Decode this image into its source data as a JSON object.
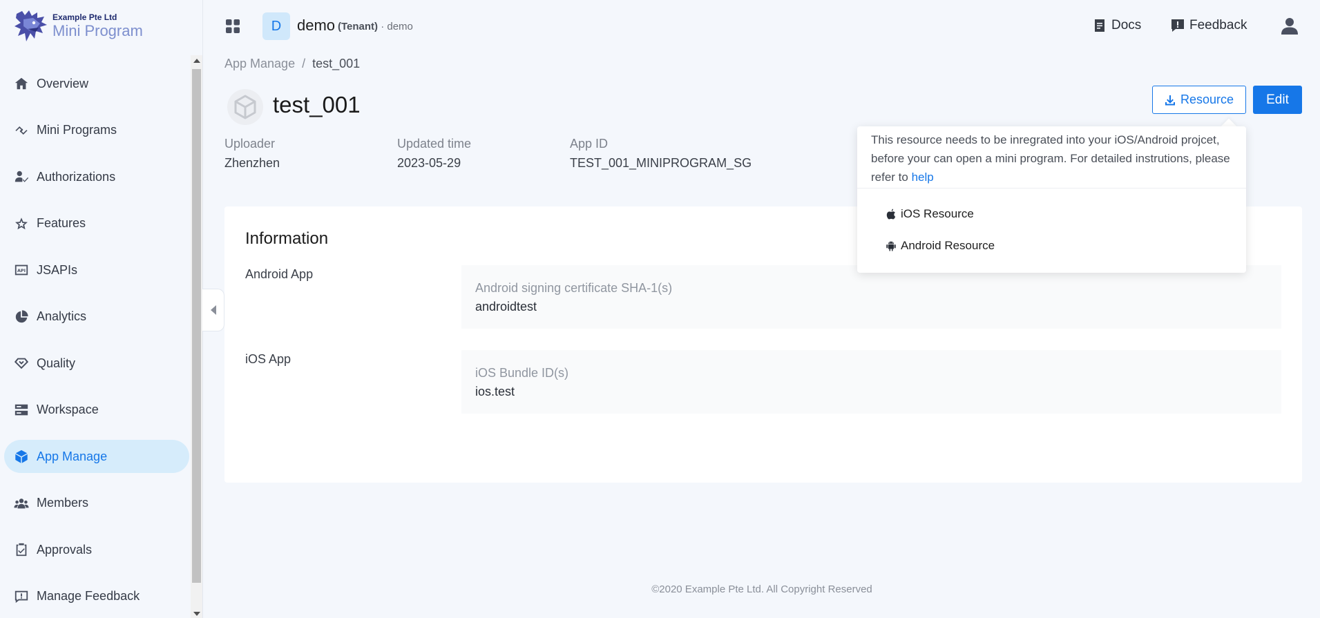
{
  "logo": {
    "company": "Example Pte Ltd",
    "product": "Mini Program",
    "icon": "dragon-logo-icon"
  },
  "sidebar": {
    "items": [
      {
        "label": "Overview",
        "icon": "home-icon"
      },
      {
        "label": "Mini Programs",
        "icon": "link-icon"
      },
      {
        "label": "Authorizations",
        "icon": "user-check-icon"
      },
      {
        "label": "Features",
        "icon": "star-icon"
      },
      {
        "label": "JSAPIs",
        "icon": "api-icon"
      },
      {
        "label": "Analytics",
        "icon": "pie-chart-icon"
      },
      {
        "label": "Quality",
        "icon": "diamond-icon"
      },
      {
        "label": "Workspace",
        "icon": "server-icon"
      },
      {
        "label": "App Manage",
        "icon": "cube-icon",
        "active": true
      },
      {
        "label": "Members",
        "icon": "team-icon"
      },
      {
        "label": "Approvals",
        "icon": "clipboard-check-icon"
      },
      {
        "label": "Manage Feedback",
        "icon": "message-alert-icon"
      }
    ]
  },
  "header": {
    "tenant_initial": "D",
    "tenant_name": "demo",
    "tenant_type": "(Tenant)",
    "tenant_meta": " · demo",
    "docs_label": "Docs",
    "feedback_label": "Feedback"
  },
  "breadcrumb": {
    "parent": "App Manage",
    "separator": "/",
    "current": "test_001"
  },
  "app": {
    "title": "test_001",
    "meta": [
      {
        "label": "Uploader",
        "value": "Zhenzhen"
      },
      {
        "label": "Updated time",
        "value": "2023-05-29"
      },
      {
        "label": "App ID",
        "value": "TEST_001_MINIPROGRAM_SG"
      }
    ]
  },
  "actions": {
    "resource_label": "Resource",
    "edit_label": "Edit"
  },
  "popover": {
    "text": "This resource needs to be inregrated into your iOS/Android projcet, before your can open a mini program. For detailed instrutions, please refer to ",
    "link": "help",
    "ios_label": "iOS Resource",
    "android_label": "Android Resource"
  },
  "information": {
    "title": "Information",
    "rows": [
      {
        "label": "Android App",
        "key": "Android signing certificate SHA-1(s)",
        "value": "androidtest"
      },
      {
        "label": "iOS App",
        "key": "iOS Bundle ID(s)",
        "value": "ios.test"
      }
    ]
  },
  "footer": {
    "text": "©2020 Example Pte Ltd. All Copyright Reserved"
  },
  "colors": {
    "accent": "#1677e8",
    "active_bg": "#d6ecfb",
    "page_bg": "#f4f7fc"
  }
}
